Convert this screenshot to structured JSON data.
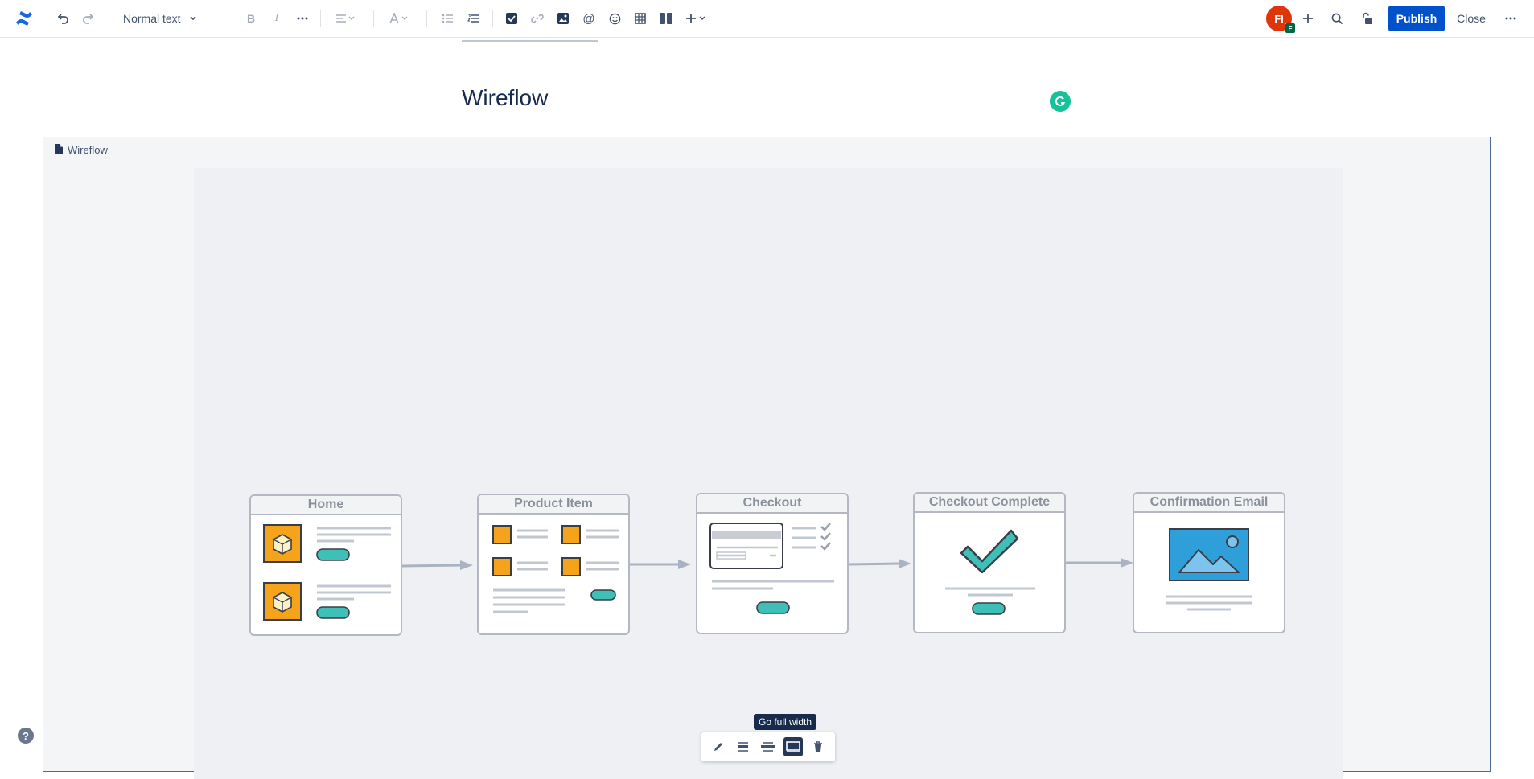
{
  "toolbar": {
    "text_style": "Normal text",
    "avatar_initials": "FI",
    "avatar_badge": "F",
    "publish_label": "Publish",
    "close_label": "Close"
  },
  "page": {
    "title": "Wireflow"
  },
  "macro": {
    "label": "Wireflow",
    "frames": [
      {
        "title": "Home"
      },
      {
        "title": "Product Item"
      },
      {
        "title": "Checkout"
      },
      {
        "title": "Checkout Complete"
      },
      {
        "title": "Confirmation Email"
      }
    ]
  },
  "image_toolbar": {
    "tooltip": "Go full width"
  },
  "help": {
    "label": "?"
  },
  "colors": {
    "brand": "#0052cc",
    "teal": "#3ebfb7",
    "orange": "#f5a31a",
    "blue_image": "#2e9fd9"
  }
}
